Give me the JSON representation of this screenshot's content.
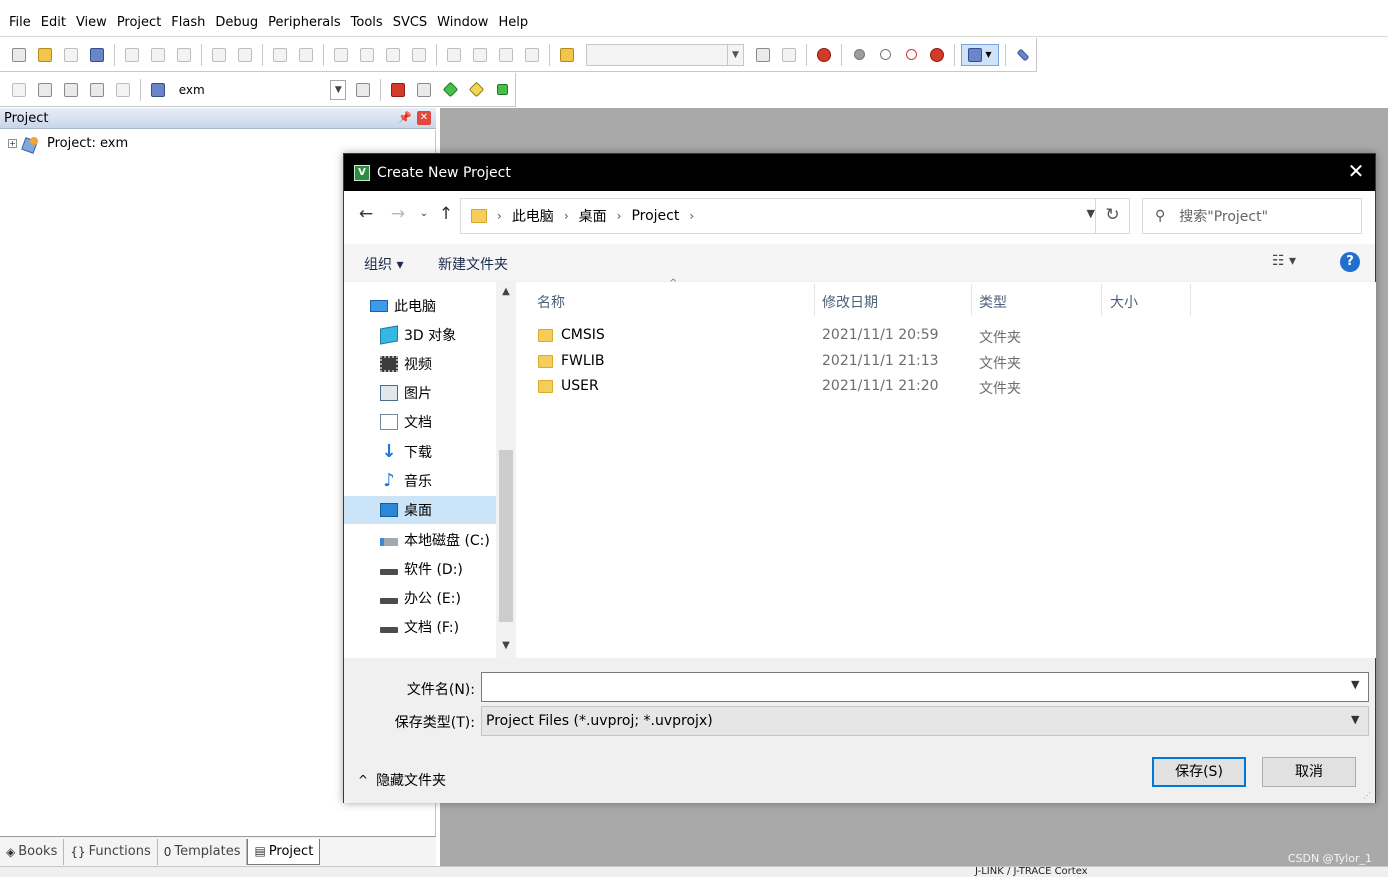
{
  "menubar": {
    "items": [
      "File",
      "Edit",
      "View",
      "Project",
      "Flash",
      "Debug",
      "Peripherals",
      "Tools",
      "SVCS",
      "Window",
      "Help"
    ]
  },
  "toolbar2": {
    "target": "exm"
  },
  "project_pane": {
    "title": "Project",
    "tree_root": "Project: exm",
    "tabs": [
      {
        "icon": "books-icon",
        "label": "Books"
      },
      {
        "icon": "functions-icon",
        "label": "Functions"
      },
      {
        "icon": "templates-icon",
        "label": "Templates"
      },
      {
        "icon": "project-icon",
        "label": "Project"
      }
    ]
  },
  "dialog": {
    "title": "Create New Project",
    "breadcrumbs": [
      "此电脑",
      "桌面",
      "Project"
    ],
    "search_placeholder": "搜索\"Project\"",
    "commands": {
      "organize": "组织 ▾",
      "new_folder": "新建文件夹"
    },
    "help_label": "?",
    "nav_items": [
      {
        "label": "此电脑",
        "icon": "pc-icon",
        "selected": false
      },
      {
        "label": "3D 对象",
        "icon": "3d-objects-icon",
        "selected": false
      },
      {
        "label": "视频",
        "icon": "video-icon",
        "selected": false
      },
      {
        "label": "图片",
        "icon": "pictures-icon",
        "selected": false
      },
      {
        "label": "文档",
        "icon": "documents-icon",
        "selected": false
      },
      {
        "label": "下载",
        "icon": "download-icon",
        "selected": false
      },
      {
        "label": "音乐",
        "icon": "music-icon",
        "selected": false
      },
      {
        "label": "桌面",
        "icon": "desktop-icon",
        "selected": true
      },
      {
        "label": "本地磁盘 (C:)",
        "icon": "drive-c-icon",
        "selected": false
      },
      {
        "label": "软件 (D:)",
        "icon": "drive-icon",
        "selected": false
      },
      {
        "label": "办公 (E:)",
        "icon": "drive-icon",
        "selected": false
      },
      {
        "label": "文档 (F:)",
        "icon": "drive-icon",
        "selected": false
      }
    ],
    "columns": {
      "name": "名称",
      "date": "修改日期",
      "type": "类型",
      "size": "大小"
    },
    "files": [
      {
        "name": "CMSIS",
        "date": "2021/11/1 20:59",
        "type": "文件夹"
      },
      {
        "name": "FWLIB",
        "date": "2021/11/1 21:13",
        "type": "文件夹"
      },
      {
        "name": "USER",
        "date": "2021/11/1 21:20",
        "type": "文件夹"
      }
    ],
    "filename_label": "文件名(N):",
    "filename_value": "",
    "filetype_label": "保存类型(T):",
    "filetype_value": "Project Files (*.uvproj; *.uvprojx)",
    "hide_folders": "隐藏文件夹",
    "save_button": "保存(S)",
    "cancel_button": "取消"
  },
  "statusbar": {
    "text": "J-LINK / J-TRACE Cortex"
  },
  "watermark": "CSDN @Tylor_1"
}
